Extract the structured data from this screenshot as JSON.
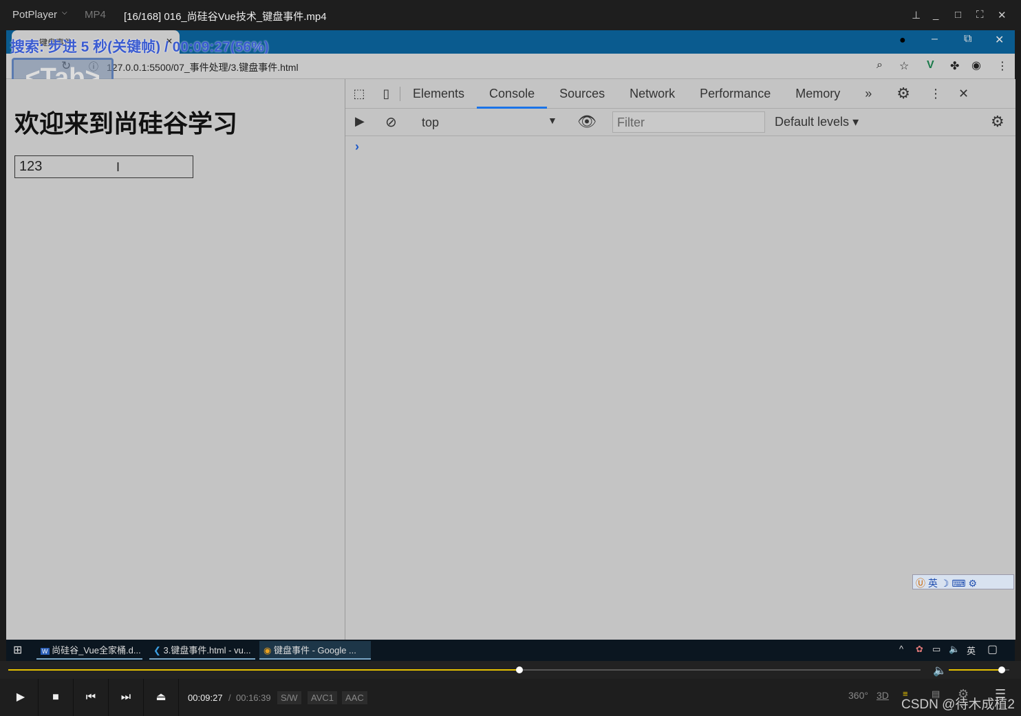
{
  "player": {
    "app": "PotPlayer",
    "format": "MP4",
    "title": "[16/168] 016_尚硅谷Vue技术_键盘事件.mp4",
    "osd": "搜索: 步进 5 秒(关键帧) / 00:09:27(56%)",
    "key_osd": "<Tab>",
    "current_time": "00:09:27",
    "total_time": "00:16:39",
    "badges": [
      "S/W",
      "AVC1",
      "AAC"
    ],
    "progress_percent": 56,
    "volume_percent": 88,
    "right_icons": [
      "360°",
      "3D"
    ],
    "watermark": "CSDN @待木成植2",
    "accent": "#e6c200"
  },
  "browser": {
    "tab_title": "键盘事件",
    "url": "127.0.0.1:5500/07_事件处理/3.键盘事件.html"
  },
  "page": {
    "heading": "欢迎来到尚硅谷学习",
    "input_value": "123"
  },
  "devtools": {
    "tabs": [
      "Elements",
      "Console",
      "Sources",
      "Network",
      "Performance",
      "Memory"
    ],
    "active_tab": "Console",
    "context": "top",
    "filter_placeholder": "Filter",
    "levels": "Default levels",
    "prompt": "›"
  },
  "taskbar": {
    "items": [
      "尚硅谷_Vue全家桶.d...",
      "3.键盘事件.html - vu...",
      "键盘事件 - Google ..."
    ],
    "ime": "英",
    "ime_bar": "英"
  }
}
